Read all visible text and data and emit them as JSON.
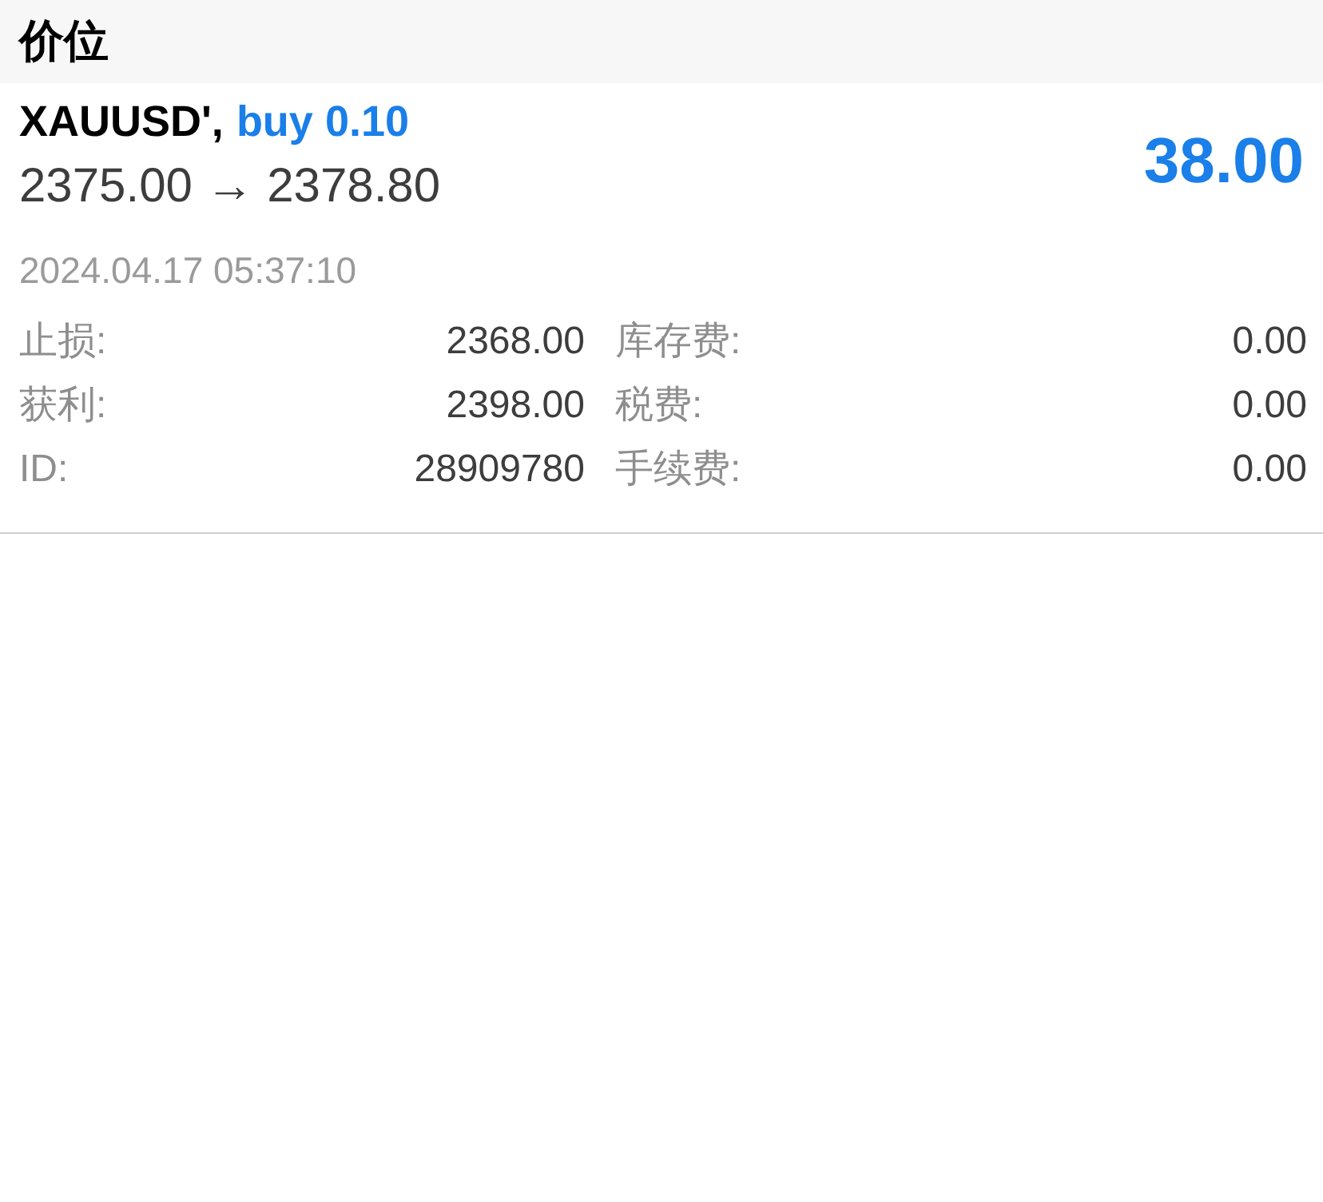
{
  "header": {
    "title": "价位"
  },
  "position": {
    "symbol": "XAUUSD',",
    "order": "buy 0.10",
    "prices": "2375.00 → 2378.80",
    "profit": "38.00",
    "time": "2024.04.17 05:37:10"
  },
  "details": [
    {
      "label": "止损:",
      "value": "2368.00"
    },
    {
      "label": "库存费:",
      "value": "0.00"
    },
    {
      "label": "获利:",
      "value": "2398.00"
    },
    {
      "label": "税费:",
      "value": "0.00"
    },
    {
      "label": "ID:",
      "value": "28909780"
    },
    {
      "label": "手续费:",
      "value": "0.00"
    }
  ]
}
